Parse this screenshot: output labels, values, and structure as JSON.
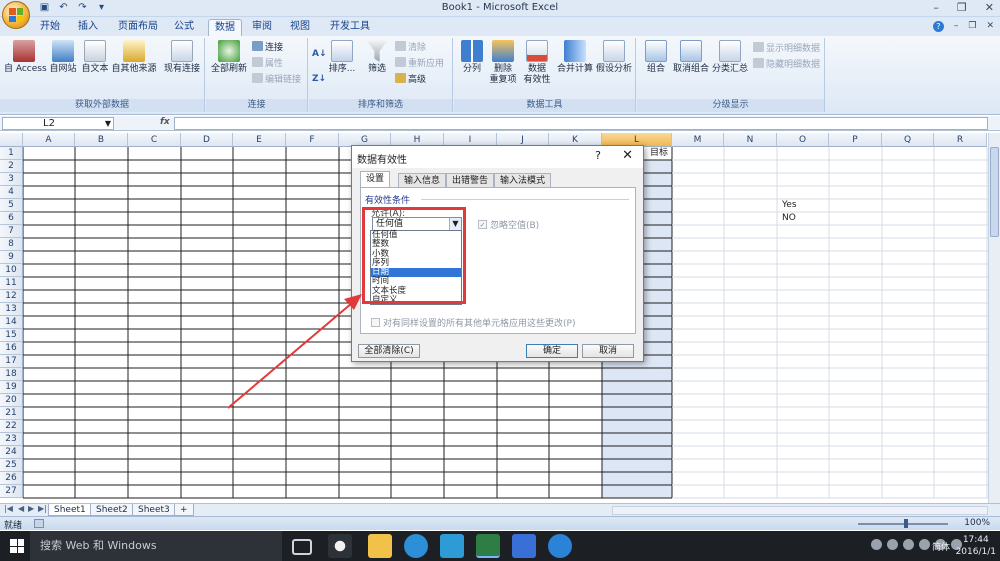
{
  "window": {
    "title": "Book1 - Microsoft Excel"
  },
  "ribbon": {
    "tabs": [
      "开始",
      "插入",
      "页面布局",
      "公式",
      "数据",
      "审阅",
      "视图",
      "开发工具"
    ],
    "active_tab": "数据",
    "groups": {
      "external": {
        "label": "获取外部数据",
        "buttons": [
          "自 Access",
          "自网站",
          "自文本",
          "自其他来源",
          "现有连接"
        ]
      },
      "connections": {
        "label": "连接",
        "refresh": "全部刷新",
        "small": [
          "连接",
          "属性",
          "编辑链接"
        ]
      },
      "sort_filter": {
        "label": "排序和筛选",
        "sort": "排序...",
        "filter": "筛选",
        "small": [
          "清除",
          "重新应用",
          "高级"
        ]
      },
      "data_tools": {
        "label": "数据工具",
        "buttons": [
          "分列",
          "删除\n重复项",
          "数据\n有效性",
          "合并计算",
          "假设分析"
        ]
      },
      "outline": {
        "label": "分级显示",
        "buttons": [
          "组合",
          "取消组合",
          "分类汇总"
        ],
        "small": [
          "显示明细数据",
          "隐藏明细数据"
        ]
      }
    }
  },
  "formula_bar": {
    "name_box": "L2",
    "fx": "fx",
    "value": ""
  },
  "grid": {
    "columns": [
      "A",
      "B",
      "C",
      "D",
      "E",
      "F",
      "G",
      "H",
      "I",
      "J",
      "K",
      "L",
      "M",
      "N",
      "O",
      "P",
      "Q",
      "R"
    ],
    "selected_column": "L",
    "rows": [
      "1",
      "2",
      "3",
      "4",
      "5",
      "6",
      "7",
      "8",
      "9",
      "10",
      "11",
      "12",
      "13",
      "14",
      "15",
      "16",
      "17",
      "18",
      "19",
      "20",
      "21",
      "22",
      "23",
      "24",
      "25",
      "26",
      "27"
    ],
    "cells": {
      "L1": "目标",
      "O5": "Yes",
      "O6": "NO"
    }
  },
  "sheets": {
    "tabs": [
      "Sheet1",
      "Sheet2",
      "Sheet3"
    ],
    "active": "Sheet1"
  },
  "status_bar": {
    "text": "就绪",
    "zoom": "100%"
  },
  "dialog": {
    "title": "数据有效性",
    "help": "?",
    "tabs": [
      "设置",
      "输入信息",
      "出错警告",
      "输入法模式"
    ],
    "active_tab": "设置",
    "section": "有效性条件",
    "allow_label": "允许(A):",
    "allow_value": "任何值",
    "ignore_blank": "忽略空值(B)",
    "options": [
      "任何值",
      "整数",
      "小数",
      "序列",
      "日期",
      "时间",
      "文本长度",
      "自定义"
    ],
    "selected_option": "日期",
    "apply_all": "对有同样设置的所有其他单元格应用这些更改(P)",
    "buttons": {
      "clear": "全部清除(C)",
      "ok": "确定",
      "cancel": "取消"
    }
  },
  "taskbar": {
    "search": "搜索 Web 和 Windows",
    "ime": "简体",
    "time": "17:44",
    "date": "2016/1/1"
  },
  "colors": {
    "ribbon_bg": "#dde8f5",
    "selection": "#3175d6",
    "annotation": "#e23a3a",
    "taskbar": "#1c1f24"
  }
}
